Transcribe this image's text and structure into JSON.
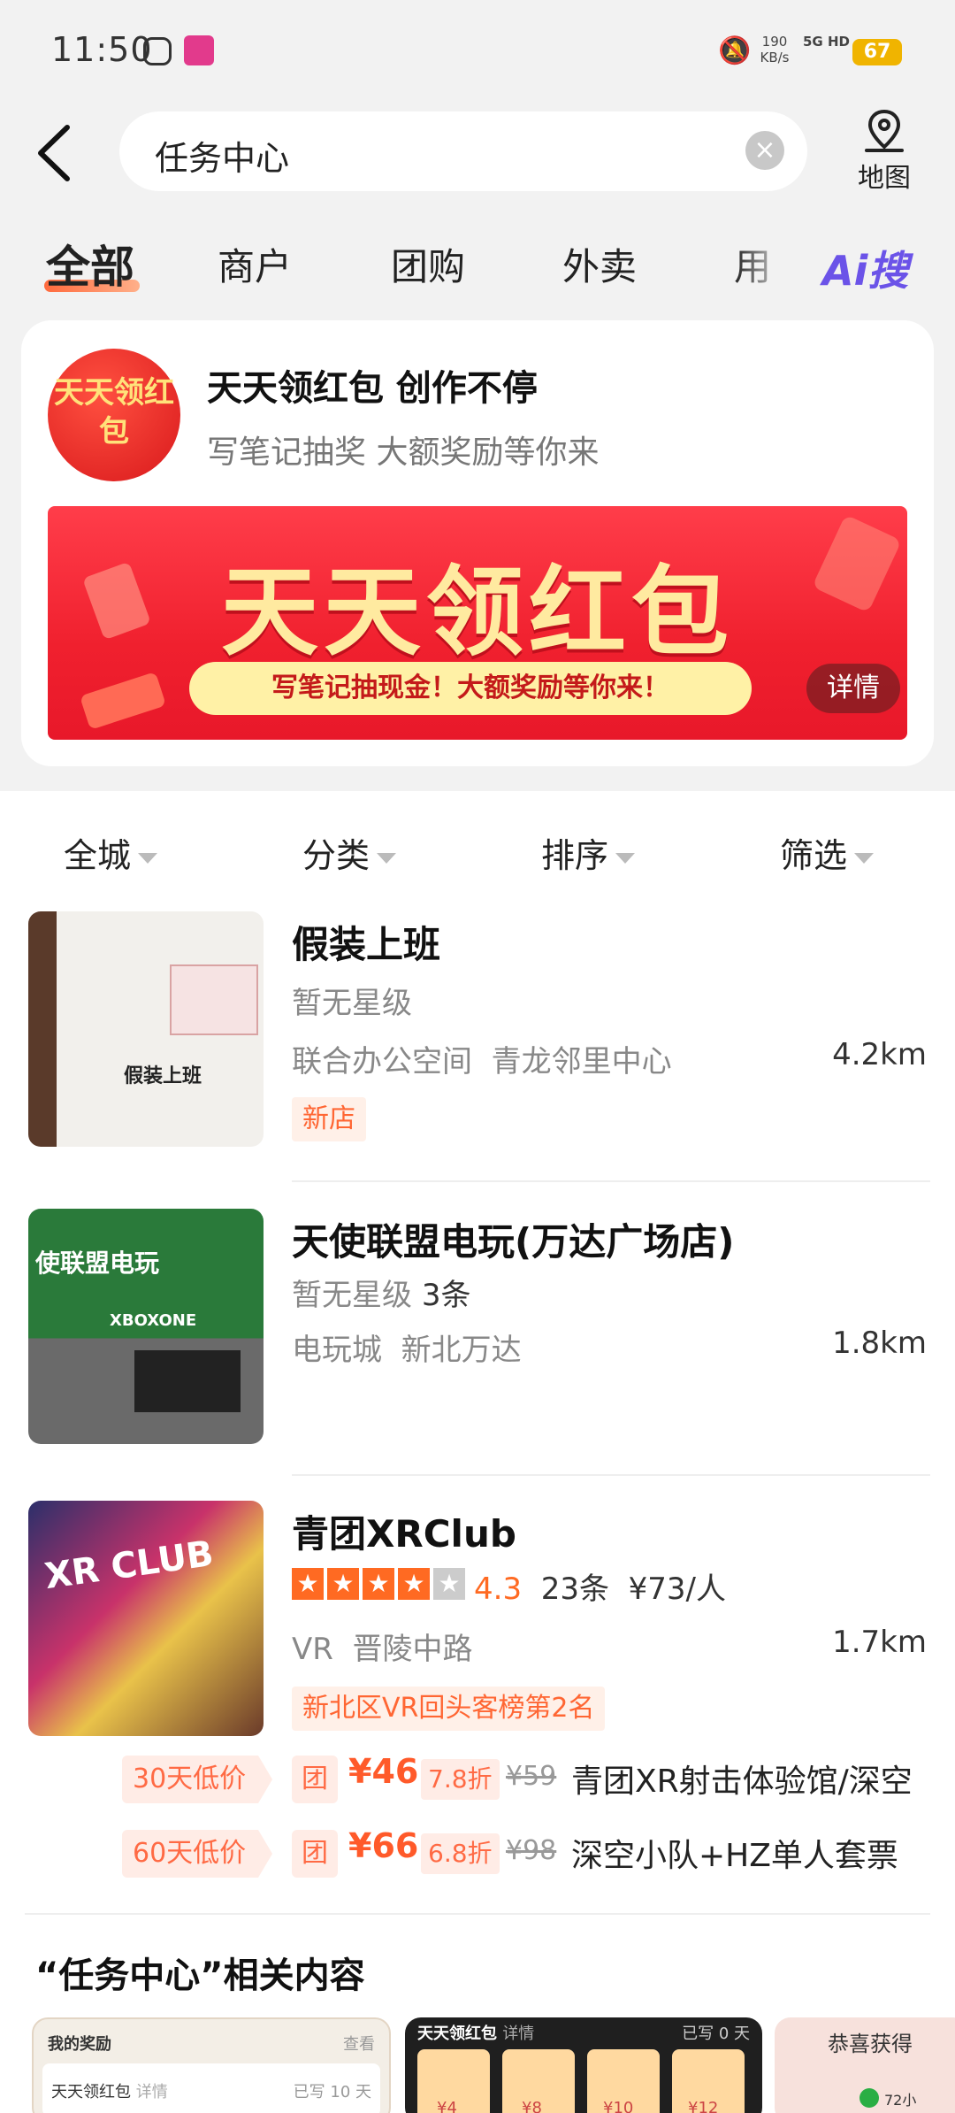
{
  "status_bar": {
    "time": "11:50",
    "net_speed": "190",
    "net_speed_unit": "KB/s",
    "network": "5G HD",
    "battery": "67"
  },
  "search": {
    "query": "任务中心",
    "map_label": "地图"
  },
  "tabs": [
    {
      "label": "全部",
      "active": true
    },
    {
      "label": "商户"
    },
    {
      "label": "团购"
    },
    {
      "label": "外卖"
    },
    {
      "label": "用"
    }
  ],
  "ai_tab": "Ai搜",
  "promo": {
    "logo_text": "天天领红包",
    "title": "天天领红包 创作不停",
    "subtitle": "写笔记抽奖 大额奖励等你来",
    "banner_title": "天天领红包",
    "banner_sub": "写笔记抽现金！大额奖励等你来！",
    "banner_detail": "详情"
  },
  "filters": [
    "全城",
    "分类",
    "排序",
    "筛选"
  ],
  "listings": [
    {
      "name": "假装上班",
      "rating_text": "暂无星级",
      "category": "联合办公空间",
      "area": "青龙邻里中心",
      "distance": "4.2km",
      "tag": "新店",
      "thumb_text": "假装上班"
    },
    {
      "name": "天使联盟电玩(万达广场店)",
      "rating_text": "暂无星级",
      "review_count": "3条",
      "category": "电玩城",
      "area": "新北万达",
      "distance": "1.8km",
      "thumb_text": "使联盟电玩",
      "thumb_sub": "XBOXONE"
    },
    {
      "name": "青团XRClub",
      "stars": 4,
      "score": "4.3",
      "review_count": "23条",
      "price_per": "¥73/人",
      "category": "VR",
      "area": "晋陵中路",
      "distance": "1.7km",
      "tag": "新北区VR回头客榜第2名",
      "thumb_text": "XR CLUB",
      "deals": [
        {
          "badge": "30天低价",
          "tuan": "团",
          "price": "¥46",
          "discount": "7.8折",
          "original": "¥59",
          "title": "青团XR射击体验馆/深空"
        },
        {
          "badge": "60天低价",
          "tuan": "团",
          "price": "¥66",
          "discount": "6.8折",
          "original": "¥98",
          "title": "深空小队+HZ单人套票"
        }
      ]
    }
  ],
  "related": {
    "title": "“任务中心”相关内容",
    "card1_title": "我的奖励",
    "card1_link": "查看",
    "card1_row": "天天领红包",
    "card1_row_sub": "详情",
    "card1_row_right": "已写 10 天",
    "card2_title": "天天领红包",
    "card2_sub": "详情",
    "card2_right": "已写 0 天",
    "card2_prizes": [
      "¥4",
      "¥8",
      "¥10",
      "¥12"
    ],
    "card3_text": "恭喜获得",
    "card3_sub": "72小"
  }
}
